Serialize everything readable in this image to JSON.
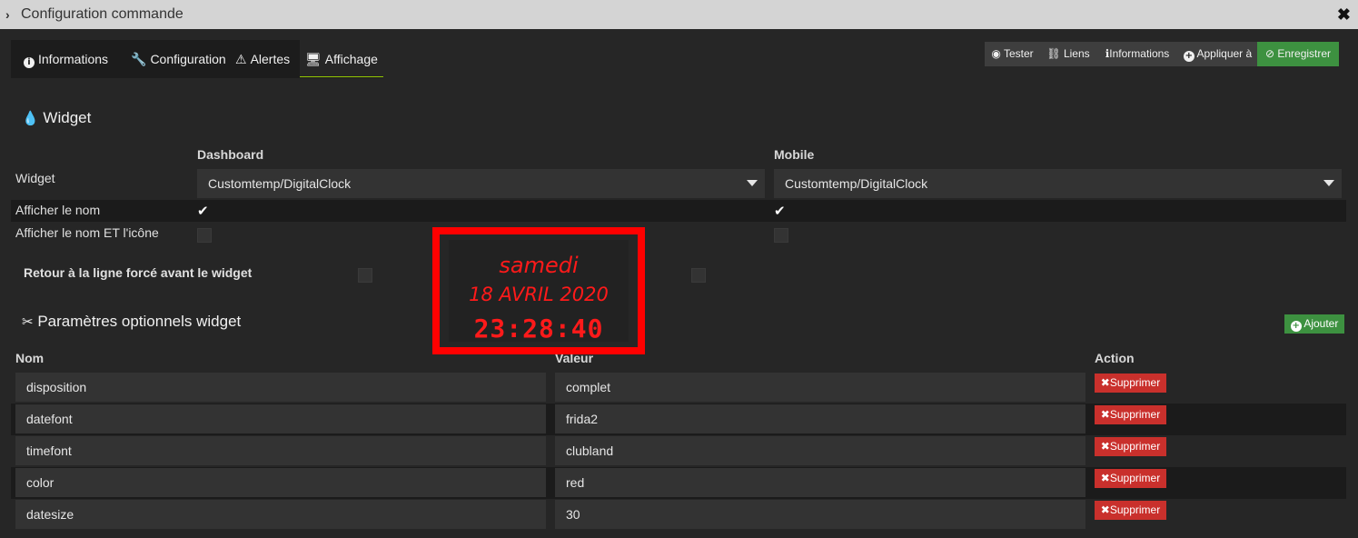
{
  "window": {
    "title": "Configuration commande",
    "close": "✖"
  },
  "tabs": [
    {
      "label": "Informations",
      "icon": "info-circle-icon"
    },
    {
      "label": "Configuration",
      "icon": "wrench-icon"
    },
    {
      "label": "Alertes",
      "icon": "warning-icon"
    },
    {
      "label": "Affichage",
      "icon": "monitor-icon",
      "active": true
    }
  ],
  "toolbar": {
    "tester": "Tester",
    "liens": "Liens",
    "informations": "Informations",
    "appliquer": "Appliquer à",
    "enregistrer": "Enregistrer"
  },
  "widget_section": {
    "title": "Widget",
    "dashboard_header": "Dashboard",
    "mobile_header": "Mobile",
    "widget_label": "Widget",
    "dashboard_widget": "Customtemp/DigitalClock",
    "mobile_widget": "Customtemp/DigitalClock",
    "show_name_label": "Afficher le nom",
    "show_name_icon_label": "Afficher le nom ET l'icône",
    "line_break_label": "Retour à la ligne forcé avant le widget",
    "show_name_dashboard": true,
    "show_name_mobile": true,
    "show_name_icon_dashboard": false,
    "show_name_icon_mobile": false
  },
  "preview": {
    "day": "samedi",
    "date": "18 AVRIL 2020",
    "time": "23:28:40",
    "color": "#ff1a1a"
  },
  "params": {
    "title": "Paramètres optionnels widget",
    "add_label": "Ajouter",
    "col_name": "Nom",
    "col_value": "Valeur",
    "col_action": "Action",
    "delete_label": "Supprimer",
    "rows": [
      {
        "name": "disposition",
        "value": "complet"
      },
      {
        "name": "datefont",
        "value": "frida2"
      },
      {
        "name": "timefont",
        "value": "clubland"
      },
      {
        "name": "color",
        "value": "red"
      },
      {
        "name": "datesize",
        "value": "30"
      }
    ]
  },
  "colors": {
    "accent_green": "#3d9140",
    "danger_red": "#c9302c",
    "tab_underline": "#94ca02"
  }
}
